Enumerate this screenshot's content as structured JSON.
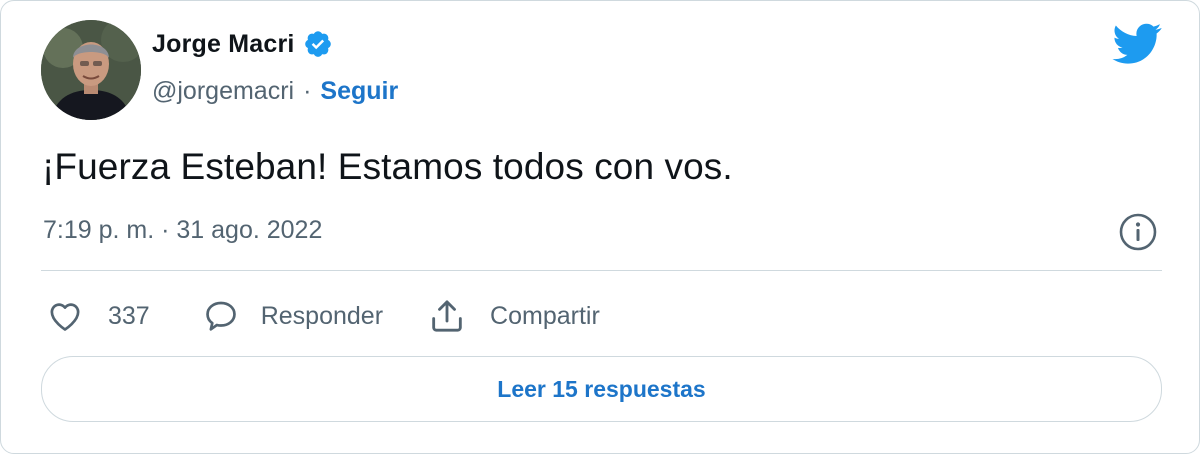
{
  "author": {
    "name": "Jorge Macri",
    "handle": "@jorgemacri",
    "separator": "·",
    "follow_label": "Seguir",
    "verified": true,
    "avatar_icon": "profile-photo"
  },
  "tweet": {
    "text": "¡Fuerza Esteban! Estamos todos con vos.",
    "timestamp": "7:19 p. m. · 31 ago. 2022"
  },
  "actions": {
    "like_count": "337",
    "reply_label": "Responder",
    "share_label": "Compartir"
  },
  "read_more_label": "Leer 15 respuestas",
  "icons": {
    "brand": "twitter-bird-icon",
    "verified": "verified-badge-icon",
    "info": "info-icon",
    "like": "heart-icon",
    "reply": "speech-bubble-icon",
    "share": "share-upload-icon"
  },
  "colors": {
    "brand_blue": "#1d9bf0",
    "link_blue": "#1d75c9",
    "text": "#0f1419",
    "secondary_text": "#536471",
    "border": "#cfd9de"
  }
}
